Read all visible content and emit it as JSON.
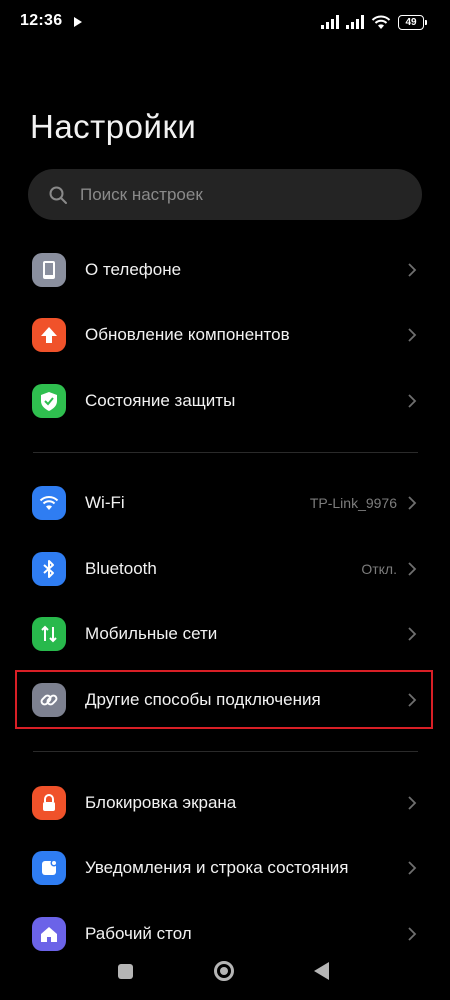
{
  "status_bar": {
    "time": "12:36",
    "battery": "49"
  },
  "page": {
    "title": "Настройки"
  },
  "search": {
    "placeholder": "Поиск настроек"
  },
  "colors": {
    "about_phone": "#8a8f9e",
    "update": "#f0522a",
    "security": "#2fbf4f",
    "wifi": "#2f7df2",
    "bluetooth": "#2f7df2",
    "mobile": "#28b94c",
    "connections": "#7d8190",
    "lock_screen": "#f0522a",
    "notifications": "#2f7df2",
    "desktop": "#6b63e8",
    "highlight": "#d91f26"
  },
  "groups": [
    {
      "items": [
        {
          "label": "О телефоне",
          "icon": "phone-icon"
        },
        {
          "label": "Обновление компонентов",
          "icon": "arrow-up-icon"
        },
        {
          "label": "Состояние защиты",
          "icon": "shield-check-icon"
        }
      ]
    },
    {
      "items": [
        {
          "label": "Wi-Fi",
          "value": "TP-Link_9976",
          "icon": "wifi-icon"
        },
        {
          "label": "Bluetooth",
          "value": "Откл.",
          "icon": "bluetooth-icon"
        },
        {
          "label": "Мобильные сети",
          "icon": "mobile-data-icon"
        },
        {
          "label": "Другие способы подключения",
          "icon": "link-icon",
          "highlighted": true
        }
      ]
    },
    {
      "items": [
        {
          "label": "Блокировка экрана",
          "icon": "lock-icon"
        },
        {
          "label": "Уведомления и строка состояния",
          "icon": "notification-icon"
        },
        {
          "label": "Рабочий стол",
          "icon": "home-icon"
        }
      ]
    }
  ]
}
